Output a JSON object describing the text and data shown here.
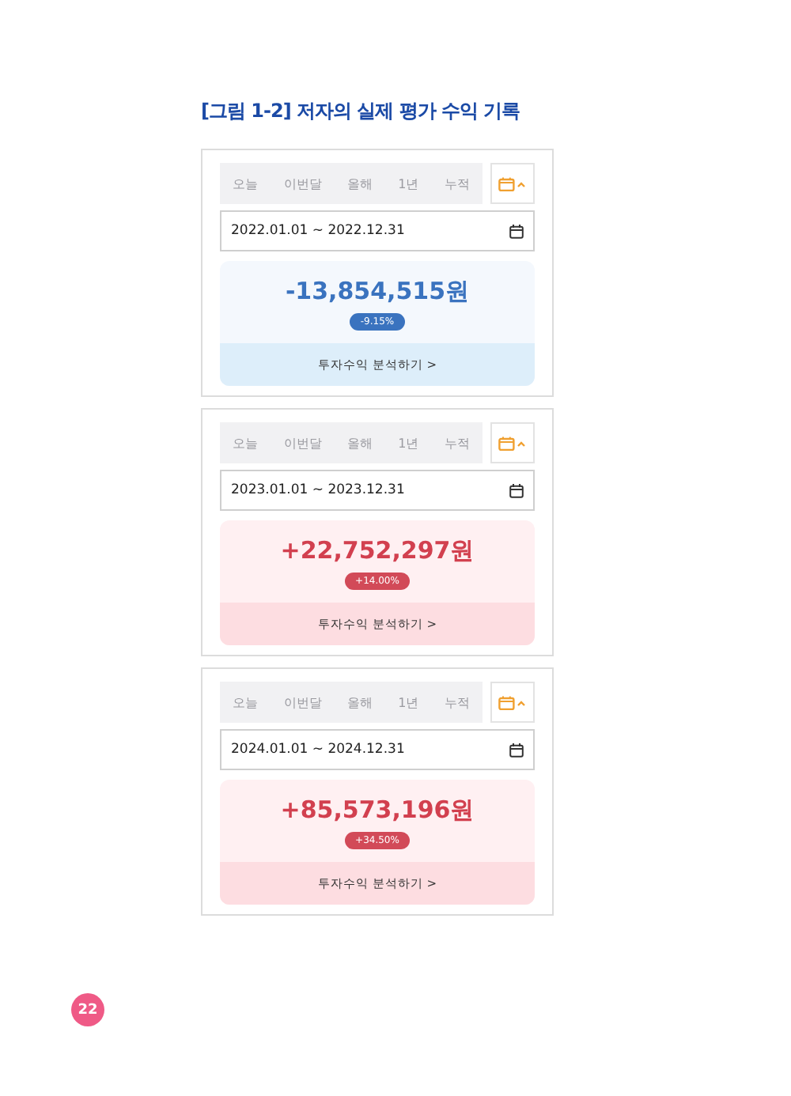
{
  "title": "[그림 1-2] 저자의 실제 평가 수익 기록",
  "panels": [
    {
      "tabs": [
        {
          "label": "오늘",
          "selected": false
        },
        {
          "label": "이번달",
          "selected": false
        },
        {
          "label": "올해",
          "selected": false
        },
        {
          "label": "1년",
          "selected": false
        },
        {
          "label": "누적",
          "selected": false
        }
      ],
      "date_range": "2022.01.01 ~ 2022.12.31",
      "kind": "loss",
      "amount": "-13,854,515원",
      "rate": "-9.15%",
      "link": "투자수익 분석하기 >"
    },
    {
      "tabs": [
        {
          "label": "오늘",
          "selected": false
        },
        {
          "label": "이번달",
          "selected": false
        },
        {
          "label": "올해",
          "selected": false
        },
        {
          "label": "1년",
          "selected": false
        },
        {
          "label": "누적",
          "selected": false
        }
      ],
      "date_range": "2023.01.01 ~ 2023.12.31",
      "kind": "gain",
      "amount": "+22,752,297원",
      "rate": "+14.00%",
      "link": "투자수익 분석하기 >"
    },
    {
      "tabs": [
        {
          "label": "오늘",
          "selected": false
        },
        {
          "label": "이번달",
          "selected": false
        },
        {
          "label": "올해",
          "selected": false
        },
        {
          "label": "1년",
          "selected": false
        },
        {
          "label": "누적",
          "selected": false
        }
      ],
      "date_range": "2024.01.01 ~ 2024.12.31",
      "kind": "gain",
      "amount": "+85,573,196원",
      "rate": "+34.50%",
      "link": "투자수익 분석하기 >"
    }
  ],
  "page_number": "22"
}
